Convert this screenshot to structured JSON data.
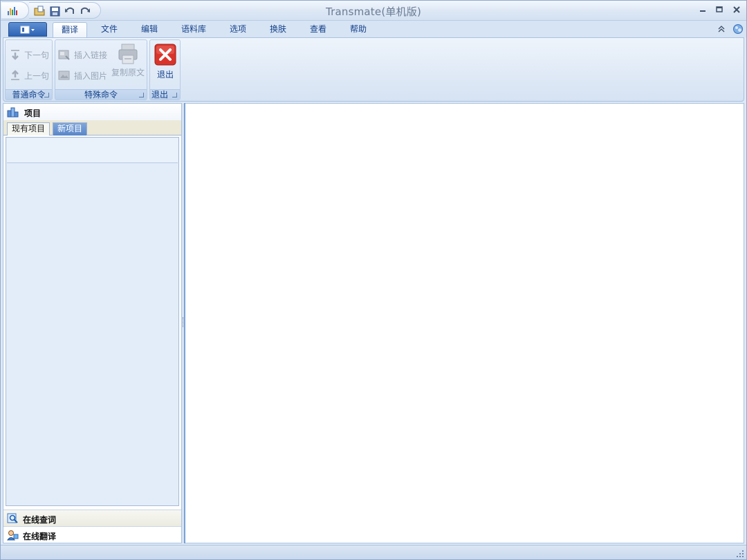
{
  "window": {
    "title": "Transmate(单机版)"
  },
  "quick_access": [
    {
      "name": "open-icon"
    },
    {
      "name": "save-icon"
    },
    {
      "name": "undo-icon"
    },
    {
      "name": "redo-icon"
    }
  ],
  "ribbon_tabs": [
    {
      "label": "翻译",
      "active": true
    },
    {
      "label": "文件"
    },
    {
      "label": "编辑"
    },
    {
      "label": "语料库"
    },
    {
      "label": "选项"
    },
    {
      "label": "换肤"
    },
    {
      "label": "查看"
    },
    {
      "label": "帮助"
    }
  ],
  "ribbon": {
    "general": {
      "label": "普通命令",
      "next": "下一句",
      "prev": "上一句"
    },
    "special": {
      "label": "特殊命令",
      "insert_link": "插入链接",
      "insert_image": "插入图片",
      "copy_source": "复制原文"
    },
    "exit": {
      "label": "退出",
      "button": "退出"
    }
  },
  "left_pane": {
    "title": "项目",
    "tabs": {
      "existing": "现有项目",
      "new": "新项目"
    },
    "nav": {
      "lookup": "在线查词",
      "mt": "在线翻译"
    }
  },
  "colors": {
    "accent": "#15428b",
    "exit_red": "#d9342b",
    "tab_blue": "#5a86c8"
  }
}
